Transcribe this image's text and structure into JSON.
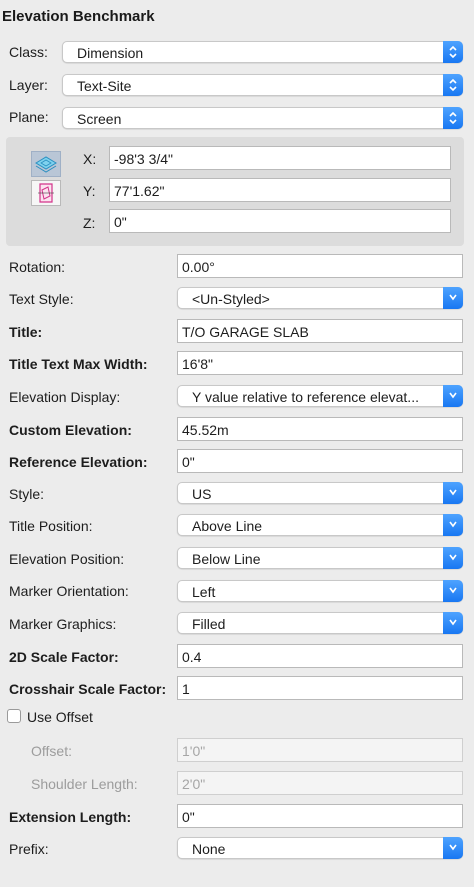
{
  "panel_title": "Elevation Benchmark",
  "class": {
    "label": "Class:",
    "value": "Dimension"
  },
  "layer": {
    "label": "Layer:",
    "value": "Text-Site"
  },
  "plane": {
    "label": "Plane:",
    "value": "Screen"
  },
  "coords": {
    "x_label": "X:",
    "x_value": "-98'3 3/4\"",
    "y_label": "Y:",
    "y_value": "77'1.62\"",
    "z_label": "Z:",
    "z_value": "0\""
  },
  "rotation": {
    "label": "Rotation:",
    "value": "0.00°"
  },
  "text_style": {
    "label": "Text Style:",
    "value": "<Un-Styled>"
  },
  "title_field": {
    "label": "Title:",
    "value": "T/O GARAGE SLAB"
  },
  "title_max_width": {
    "label": "Title Text Max Width:",
    "value": "16'8\""
  },
  "elevation_display": {
    "label": "Elevation Display:",
    "value": "Y value relative to reference elevat..."
  },
  "custom_elevation": {
    "label": "Custom Elevation:",
    "value": "45.52m"
  },
  "reference_elevation": {
    "label": "Reference Elevation:",
    "value": "0\""
  },
  "style": {
    "label": "Style:",
    "value": "US"
  },
  "title_position": {
    "label": "Title Position:",
    "value": "Above Line"
  },
  "elevation_position": {
    "label": "Elevation Position:",
    "value": "Below Line"
  },
  "marker_orientation": {
    "label": "Marker Orientation:",
    "value": "Left"
  },
  "marker_graphics": {
    "label": "Marker Graphics:",
    "value": "Filled"
  },
  "scale_2d": {
    "label": "2D Scale Factor:",
    "value": "0.4"
  },
  "crosshair_scale": {
    "label": "Crosshair Scale Factor:",
    "value": "1"
  },
  "use_offset": {
    "label": "Use Offset",
    "checked": false
  },
  "offset": {
    "label": "Offset:",
    "value": "1'0\""
  },
  "shoulder_length": {
    "label": "Shoulder Length:",
    "value": "2'0\""
  },
  "extension_length": {
    "label": "Extension Length:",
    "value": "0\""
  },
  "prefix": {
    "label": "Prefix:",
    "value": "None"
  },
  "colors": {
    "accent": "#1877f2",
    "panel_bg": "#ececec"
  },
  "icons": [
    "top-plane-icon",
    "layer-plane-icon",
    "dropdown-arrows-icon"
  ]
}
